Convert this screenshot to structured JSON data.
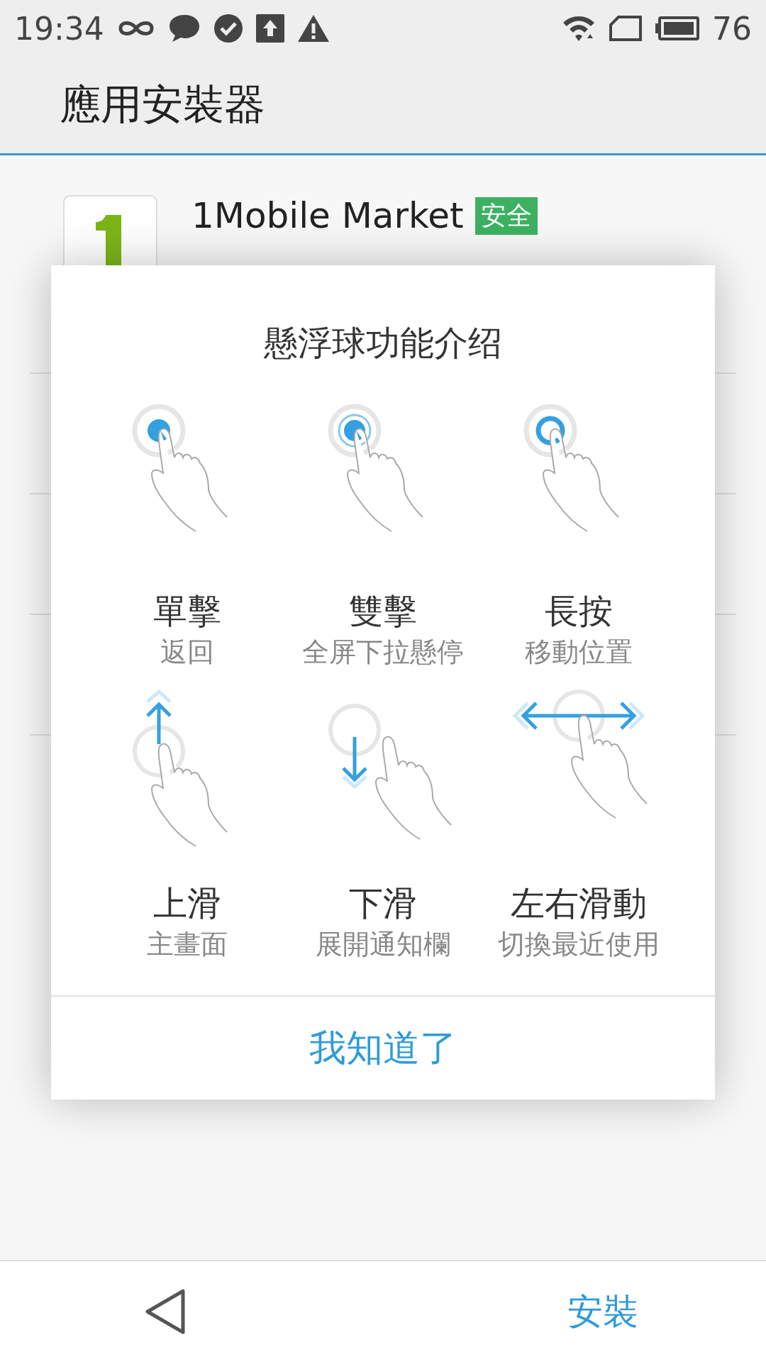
{
  "status_bar": {
    "time": "19:34",
    "battery": "76"
  },
  "app_bar": {
    "title": "應用安裝器"
  },
  "app": {
    "name": "1Mobile Market",
    "badge": "安全"
  },
  "dialog": {
    "title": "懸浮球功能介绍",
    "gestures": [
      {
        "kind": "tap",
        "label": "單擊",
        "description": "返回"
      },
      {
        "kind": "double_tap",
        "label": "雙擊",
        "description": "全屏下拉懸停"
      },
      {
        "kind": "long_press",
        "label": "長按",
        "description": "移動位置"
      },
      {
        "kind": "swipe_up",
        "label": "上滑",
        "description": "主畫面"
      },
      {
        "kind": "swipe_down",
        "label": "下滑",
        "description": "展開通知欄"
      },
      {
        "kind": "swipe_sideways",
        "label": "左右滑動",
        "description": "切換最近使用"
      }
    ],
    "button": "我知道了"
  },
  "bottom_bar": {
    "action": "安裝"
  }
}
